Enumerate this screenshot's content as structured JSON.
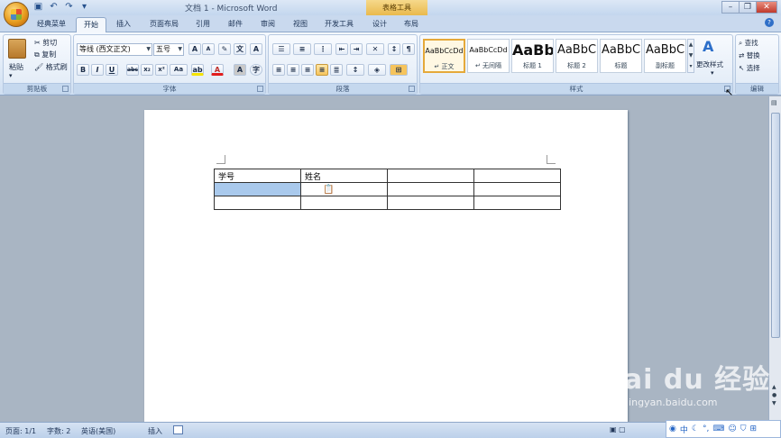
{
  "window": {
    "title": "文档 1 - Microsoft Word",
    "context_tool": "表格工具"
  },
  "tabs": [
    "经典菜单",
    "开始",
    "插入",
    "页面布局",
    "引用",
    "邮件",
    "审阅",
    "视图",
    "开发工具",
    "设计",
    "布局"
  ],
  "active_tab": "开始",
  "clipboard": {
    "paste": "粘贴",
    "cut": "剪切",
    "copy": "复制",
    "format_painter": "格式刷",
    "group_label": "剪贴板"
  },
  "font": {
    "family": "等线 (西文正文)",
    "size": "五号",
    "group_label": "字体"
  },
  "paragraph": {
    "group_label": "段落"
  },
  "styles": {
    "items": [
      {
        "sample": "AaBbCcDd",
        "name": "↵ 正文"
      },
      {
        "sample": "AaBbCcDd",
        "name": "↵ 无间隔"
      },
      {
        "sample": "AaBb",
        "name": "标题 1"
      },
      {
        "sample": "AaBbC",
        "name": "标题 2"
      },
      {
        "sample": "AaBbC",
        "name": "标题"
      },
      {
        "sample": "AaBbC",
        "name": "副标题"
      }
    ],
    "change_styles": "更改样式",
    "group_label": "样式"
  },
  "editing": {
    "find": "查找",
    "replace": "替换",
    "select": "选择",
    "group_label": "编辑"
  },
  "table": {
    "rows": [
      [
        "学号",
        "姓名",
        "",
        ""
      ],
      [
        "",
        "",
        "",
        ""
      ],
      [
        "",
        "",
        "",
        ""
      ]
    ]
  },
  "statusbar": {
    "page": "页面: 1/1",
    "words": "字数: 2",
    "language": "英语(美国)",
    "mode": "插入"
  },
  "ime": {
    "label": "中"
  },
  "watermark": {
    "text": "Bai du 经验",
    "sub": "jingyan.baidu.com"
  }
}
